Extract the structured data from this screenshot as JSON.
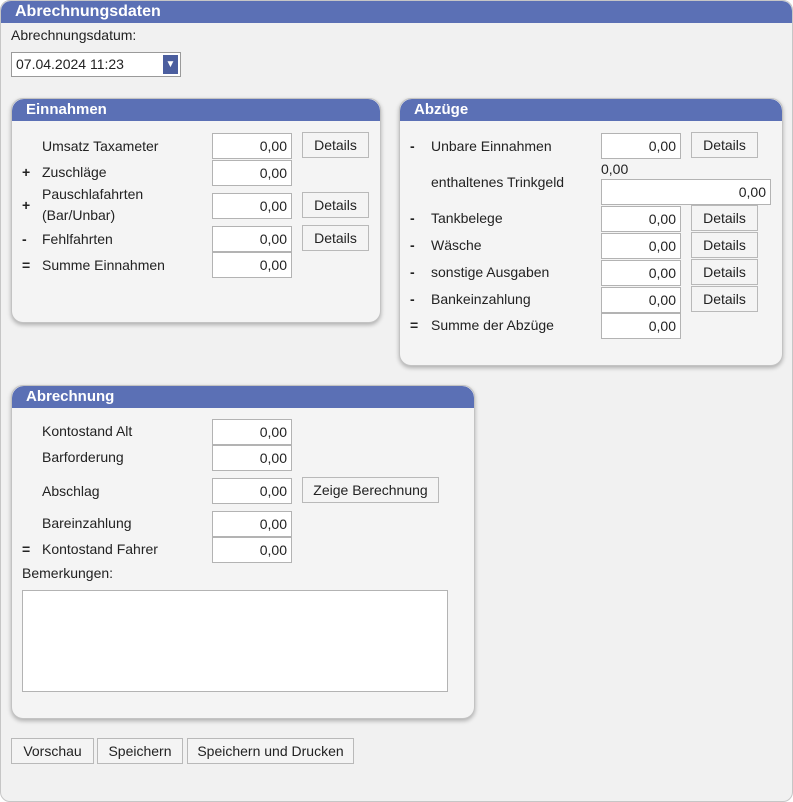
{
  "window": {
    "title": "Abrechnungsdaten"
  },
  "datum": {
    "label": "Abrechnungsdatum:",
    "value": "07.04.2024 11:23"
  },
  "einnahmen": {
    "title": "Einnahmen",
    "rows": [
      {
        "sym": "",
        "label": "Umsatz Taxameter",
        "value": "0,00",
        "button": "Details"
      },
      {
        "sym": "+",
        "label": "Zuschläge",
        "value": "0,00"
      },
      {
        "sym": "+",
        "label1": "Pauschlafahrten",
        "label2": "(Bar/Unbar)",
        "value": "0,00",
        "button": "Details"
      },
      {
        "sym": "-",
        "label": "Fehlfahrten",
        "value": "0,00",
        "button": "Details"
      },
      {
        "sym": "=",
        "label": "Summe Einnahmen",
        "value": "0,00"
      }
    ]
  },
  "abzuege": {
    "title": "Abzüge",
    "rows": [
      {
        "sym": "-",
        "label": "Unbare Einnahmen",
        "value": "0,00",
        "button": "Details"
      },
      {
        "label": "enthaltenes Trinkgeld",
        "info": "0,00",
        "value": "0,00"
      },
      {
        "sym": "-",
        "label": "Tankbelege",
        "value": "0,00",
        "button": "Details"
      },
      {
        "sym": "-",
        "label": "Wäsche",
        "value": "0,00",
        "button": "Details"
      },
      {
        "sym": "-",
        "label": "sonstige Ausgaben",
        "value": "0,00",
        "button": "Details"
      },
      {
        "sym": "-",
        "label": "Bankeinzahlung",
        "value": "0,00",
        "button": "Details"
      },
      {
        "sym": "=",
        "label": "Summe der Abzüge",
        "value": "0,00"
      }
    ]
  },
  "abrechnung": {
    "title": "Abrechnung",
    "rows": [
      {
        "label": "Kontostand Alt",
        "value": "0,00"
      },
      {
        "label": "Barforderung",
        "value": "0,00"
      },
      {
        "label": "Abschlag",
        "value": "0,00",
        "button": "Zeige Berechnung"
      },
      {
        "label": "Bareinzahlung",
        "value": "0,00"
      },
      {
        "sym": "=",
        "label": "Kontostand Fahrer",
        "value": "0,00"
      }
    ],
    "remarks_label": "Bemerkungen:",
    "remarks_value": ""
  },
  "actions": {
    "preview": "Vorschau",
    "save": "Speichern",
    "save_print": "Speichern und Drucken"
  },
  "colors": {
    "header": "#5b70b5",
    "panel_bg": "#f4f4f4",
    "frame_bg": "#f1f1f1"
  }
}
